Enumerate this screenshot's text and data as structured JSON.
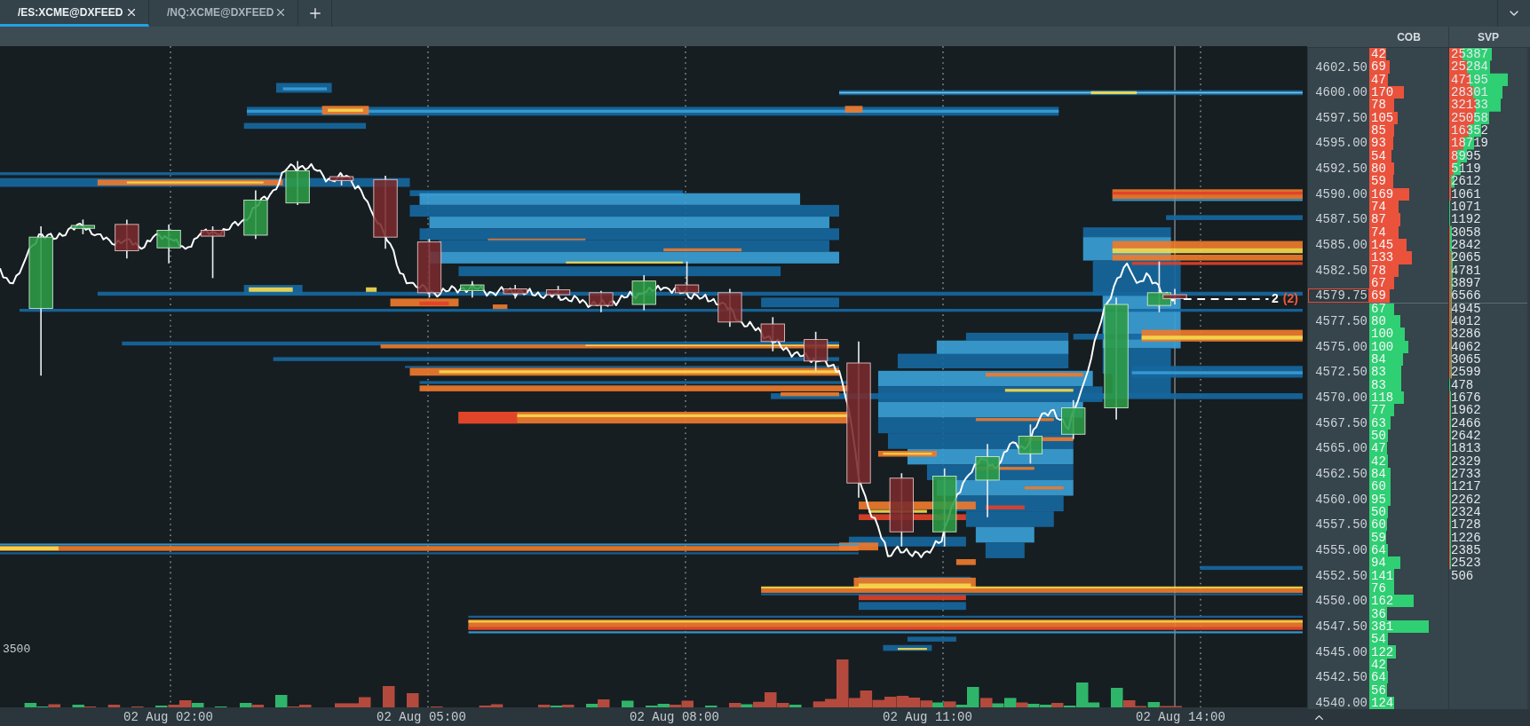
{
  "tabs": [
    {
      "label": "/ES:XCME@DXFEED",
      "selected": true
    },
    {
      "label": "/NQ:XCME@DXFEED",
      "selected": false
    }
  ],
  "chart": {
    "volume_scale_label": "3500",
    "price_marker": {
      "size": "2",
      "count": "(2)"
    }
  },
  "time_axis": {
    "labels": [
      "02 Aug 02:00",
      "02 Aug 05:00",
      "02 Aug 08:00",
      "02 Aug 11:00",
      "02 Aug 14:00"
    ]
  },
  "panel_headers": [
    "COB",
    "SVP"
  ],
  "price_axis": [
    {
      "text": "4602.50",
      "current": false
    },
    {
      "text": "4600.00",
      "current": false
    },
    {
      "text": "4597.50",
      "current": false
    },
    {
      "text": "4595.00",
      "current": false
    },
    {
      "text": "4592.50",
      "current": false
    },
    {
      "text": "4590.00",
      "current": false
    },
    {
      "text": "4587.50",
      "current": false
    },
    {
      "text": "4585.00",
      "current": false
    },
    {
      "text": "4582.50",
      "current": false
    },
    {
      "text": "4579.75",
      "current": true
    },
    {
      "text": "4577.50",
      "current": false
    },
    {
      "text": "4575.00",
      "current": false
    },
    {
      "text": "4572.50",
      "current": false
    },
    {
      "text": "4570.00",
      "current": false
    },
    {
      "text": "4567.50",
      "current": false
    },
    {
      "text": "4565.00",
      "current": false
    },
    {
      "text": "4562.50",
      "current": false
    },
    {
      "text": "4560.00",
      "current": false
    },
    {
      "text": "4557.50",
      "current": false
    },
    {
      "text": "4555.00",
      "current": false
    },
    {
      "text": "4552.50",
      "current": false
    },
    {
      "text": "4550.00",
      "current": false
    },
    {
      "text": "4547.50",
      "current": false
    },
    {
      "text": "4545.00",
      "current": false
    },
    {
      "text": "4542.50",
      "current": false
    },
    {
      "text": "4540.00",
      "current": false
    }
  ],
  "cob": {
    "rows": [
      {
        "value": "42",
        "color": "#ea523c",
        "level": 0.21
      },
      {
        "value": "69",
        "color": "#ea523c",
        "level": 0.26
      },
      {
        "value": "47",
        "color": "#ea523c",
        "level": 0.24
      },
      {
        "value": "170",
        "color": "#ea523c",
        "level": 0.44
      },
      {
        "value": "78",
        "color": "#ea523c",
        "level": 0.32
      },
      {
        "value": "105",
        "color": "#ea523c",
        "level": 0.36
      },
      {
        "value": "85",
        "color": "#ea523c",
        "level": 0.32
      },
      {
        "value": "93",
        "color": "#ea523c",
        "level": 0.3
      },
      {
        "value": "54",
        "color": "#ea523c",
        "level": 0.28
      },
      {
        "value": "80",
        "color": "#ea523c",
        "level": 0.32
      },
      {
        "value": "59",
        "color": "#ea523c",
        "level": 0.3
      },
      {
        "value": "169",
        "color": "#ea523c",
        "level": 0.5
      },
      {
        "value": "74",
        "color": "#ea523c",
        "level": 0.37
      },
      {
        "value": "87",
        "color": "#ea523c",
        "level": 0.39
      },
      {
        "value": "74",
        "color": "#ea523c",
        "level": 0.37
      },
      {
        "value": "145",
        "color": "#ea523c",
        "level": 0.47
      },
      {
        "value": "133",
        "color": "#ea523c",
        "level": 0.54
      },
      {
        "value": "78",
        "color": "#ea523c",
        "level": 0.37
      },
      {
        "value": "67",
        "color": "#ea523c",
        "level": 0.32
      },
      {
        "value": "69",
        "color": "#ea523c",
        "level": 0.26
      },
      {
        "value": "67",
        "color": "#2fcf73",
        "level": 0.32
      },
      {
        "value": "80",
        "color": "#2fcf73",
        "level": 0.39
      },
      {
        "value": "100",
        "color": "#2fcf73",
        "level": 0.45
      },
      {
        "value": "100",
        "color": "#2fcf73",
        "level": 0.49
      },
      {
        "value": "84",
        "color": "#2fcf73",
        "level": 0.43
      },
      {
        "value": "83",
        "color": "#2fcf73",
        "level": 0.41
      },
      {
        "value": "83",
        "color": "#2fcf73",
        "level": 0.4
      },
      {
        "value": "118",
        "color": "#2fcf73",
        "level": 0.44
      },
      {
        "value": "77",
        "color": "#2fcf73",
        "level": 0.32
      },
      {
        "value": "63",
        "color": "#2fcf73",
        "level": 0.27
      },
      {
        "value": "50",
        "color": "#2fcf73",
        "level": 0.24
      },
      {
        "value": "47",
        "color": "#2fcf73",
        "level": 0.22
      },
      {
        "value": "42",
        "color": "#2fcf73",
        "level": 0.24
      },
      {
        "value": "84",
        "color": "#2fcf73",
        "level": 0.27
      },
      {
        "value": "60",
        "color": "#2fcf73",
        "level": 0.27
      },
      {
        "value": "95",
        "color": "#2fcf73",
        "level": 0.27
      },
      {
        "value": "50",
        "color": "#2fcf73",
        "level": 0.24
      },
      {
        "value": "60",
        "color": "#2fcf73",
        "level": 0.22
      },
      {
        "value": "59",
        "color": "#2fcf73",
        "level": 0.21
      },
      {
        "value": "64",
        "color": "#2fcf73",
        "level": 0.24
      },
      {
        "value": "94",
        "color": "#2fcf73",
        "level": 0.39
      },
      {
        "value": "141",
        "color": "#2fcf73",
        "level": 0.32
      },
      {
        "value": "76",
        "color": "#2fcf73",
        "level": 0.32
      },
      {
        "value": "162",
        "color": "#2fcf73",
        "level": 0.56
      },
      {
        "value": "36",
        "color": "#2fcf73",
        "level": 0.22
      },
      {
        "value": "381",
        "color": "#2fcf73",
        "level": 0.75
      },
      {
        "value": "54",
        "color": "#2fcf73",
        "level": 0.24
      },
      {
        "value": "122",
        "color": "#2fcf73",
        "level": 0.34
      },
      {
        "value": "42",
        "color": "#2fcf73",
        "level": 0.22
      },
      {
        "value": "64",
        "color": "#2fcf73",
        "level": 0.24
      },
      {
        "value": "56",
        "color": "#2fcf73",
        "level": 0.22
      },
      {
        "value": "124",
        "color": "#2fcf73",
        "level": 0.32
      }
    ]
  },
  "svp": {
    "values": [
      "25387",
      "25284",
      "47195",
      "28301",
      "32133",
      "25058",
      "16352",
      "18719",
      "8995",
      "5119",
      "2612",
      "1061",
      "1071",
      "1192",
      "3058",
      "2842",
      "2065",
      "4781",
      "3897",
      "6566",
      "4945",
      "4012",
      "3286",
      "4062",
      "3065",
      "2599",
      "478",
      "1676",
      "1962",
      "2466",
      "2642",
      "1813",
      "2329",
      "2733",
      "1217",
      "2262",
      "2324",
      "1728",
      "1226",
      "2385",
      "2523",
      "506"
    ]
  }
}
